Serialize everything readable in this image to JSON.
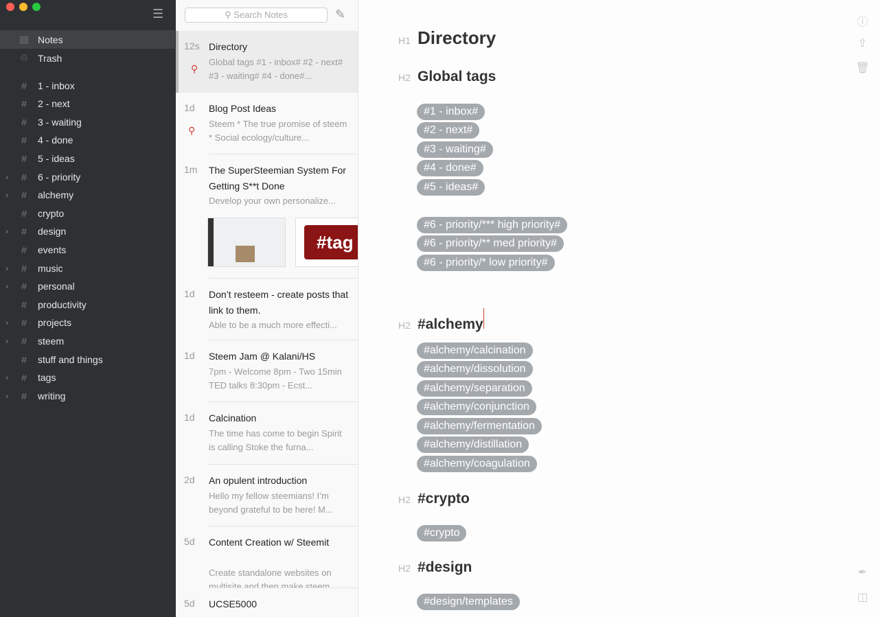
{
  "sidebar": {
    "items": [
      {
        "label": "Notes",
        "icon": "note-icon"
      },
      {
        "label": "Trash",
        "icon": "trash-icon"
      }
    ],
    "tags": [
      {
        "label": "1 - inbox",
        "expandable": false
      },
      {
        "label": "2 - next",
        "expandable": false
      },
      {
        "label": "3 - waiting",
        "expandable": false
      },
      {
        "label": "4 - done",
        "expandable": false
      },
      {
        "label": "5 - ideas",
        "expandable": false
      },
      {
        "label": "6 - priority",
        "expandable": true
      },
      {
        "label": "alchemy",
        "expandable": true
      },
      {
        "label": "crypto",
        "expandable": false
      },
      {
        "label": "design",
        "expandable": true
      },
      {
        "label": "events",
        "expandable": false
      },
      {
        "label": "music",
        "expandable": true
      },
      {
        "label": "personal",
        "expandable": true
      },
      {
        "label": "productivity",
        "expandable": false
      },
      {
        "label": "projects",
        "expandable": true
      },
      {
        "label": "steem",
        "expandable": true
      },
      {
        "label": "stuff and things",
        "expandable": false
      },
      {
        "label": "tags",
        "expandable": true
      },
      {
        "label": "writing",
        "expandable": true
      }
    ]
  },
  "list": {
    "search_placeholder": "Search Notes",
    "notes": [
      {
        "time": "12s",
        "title": "Directory",
        "preview": "Global tags #1 - inbox# #2 - next# #3 - waiting# #4 - done#...",
        "pinned": true,
        "selected": true
      },
      {
        "time": "1d",
        "title": "Blog Post Ideas",
        "preview": "Steem * The true promise of steem * Social ecology/culture...",
        "pinned": true
      },
      {
        "time": "1m",
        "title": "The SuperSteemian System For Getting S**t Done",
        "preview": "Develop your own personalize...",
        "thumb_text": "#tag"
      },
      {
        "time": "1d",
        "title": "Don’t resteem - create posts that link to them.",
        "preview": "Able to be a much more effecti..."
      },
      {
        "time": "1d",
        "title": "Steem Jam @ Kalani/HS",
        "preview": "7pm - Welcome 8pm - Two 15min TED talks 8:30pm - Ecst..."
      },
      {
        "time": "1d",
        "title": "Calcination",
        "preview": "The time has come to begin Spirit is calling Stoke the furna..."
      },
      {
        "time": "2d",
        "title": "An opulent introduction",
        "preview": "Hello my fellow steemians! I’m beyond grateful to be here! M..."
      },
      {
        "time": "5d",
        "title": "Content Creation w/ Steemit",
        "preview": "Create standalone websites on multisite and then make steem..."
      },
      {
        "time": "5d",
        "title": "UCSE5000",
        "preview": ""
      }
    ]
  },
  "editor": {
    "h1": {
      "level": "H1",
      "text": "Directory"
    },
    "sections": [
      {
        "level": "H2",
        "text": "Global tags",
        "groups": [
          [
            "#1 - inbox#",
            "#2 - next#",
            "#3 - waiting#",
            "#4 - done#",
            "#5 - ideas#"
          ],
          [
            "#6 - priority/*** high priority#",
            "#6 - priority/** med priority#",
            "#6 - priority/* low priority#"
          ]
        ]
      },
      {
        "level": "H2",
        "text": "#alchemy",
        "groups": [
          [
            "#alchemy/calcination",
            "#alchemy/dissolution",
            "#alchemy/separation",
            "#alchemy/conjunction",
            "#alchemy/fermentation",
            "#alchemy/distillation",
            "#alchemy/coagulation"
          ]
        ]
      },
      {
        "level": "H2",
        "text": "#crypto",
        "groups": [
          [
            "#crypto"
          ]
        ]
      },
      {
        "level": "H2",
        "text": "#design",
        "groups": [
          [
            "#design/templates"
          ]
        ]
      }
    ]
  },
  "colors": {
    "sidebar": "#2e3134",
    "tag_pill": "#a4a9ae",
    "pin": "#d0403c"
  }
}
